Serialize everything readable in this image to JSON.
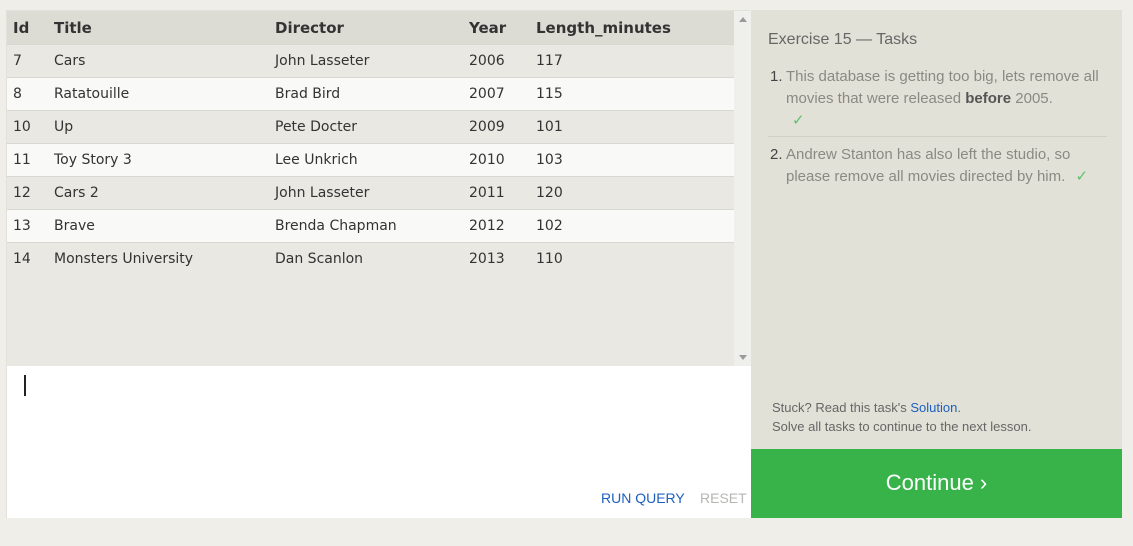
{
  "results": {
    "columns": [
      "Id",
      "Title",
      "Director",
      "Year",
      "Length_minutes"
    ],
    "rows": [
      [
        "7",
        "Cars",
        "John Lasseter",
        "2006",
        "117"
      ],
      [
        "8",
        "Ratatouille",
        "Brad Bird",
        "2007",
        "115"
      ],
      [
        "10",
        "Up",
        "Pete Docter",
        "2009",
        "101"
      ],
      [
        "11",
        "Toy Story 3",
        "Lee Unkrich",
        "2010",
        "103"
      ],
      [
        "12",
        "Cars 2",
        "John Lasseter",
        "2011",
        "120"
      ],
      [
        "13",
        "Brave",
        "Brenda Chapman",
        "2012",
        "102"
      ],
      [
        "14",
        "Monsters University",
        "Dan Scanlon",
        "2013",
        "110"
      ]
    ]
  },
  "editor": {
    "value": "",
    "run_label": "RUN QUERY",
    "reset_label": "RESET"
  },
  "tasks": {
    "title": "Exercise 15 — Tasks",
    "items": [
      {
        "num": "1.",
        "text_before": "This database is getting too big, lets remove all movies that were released ",
        "text_bold": "before",
        "text_after": " 2005.",
        "check": "✓"
      },
      {
        "num": "2.",
        "text": "Andrew Stanton has also left the studio, so please remove all movies directed by him.",
        "check": "✓"
      }
    ],
    "stuck_prefix": "Stuck? Read this task's ",
    "solution_label": "Solution",
    "stuck_suffix": ".",
    "solve_all": "Solve all tasks to continue to the next lesson.",
    "continue_label": "Continue ›"
  },
  "colors": {
    "continue_bg": "#38b34a",
    "link": "#1d5fbf",
    "check": "#5fbf6a"
  }
}
